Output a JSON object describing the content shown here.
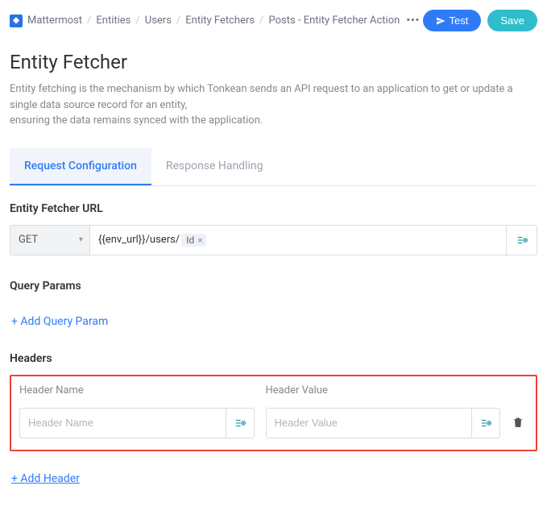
{
  "breadcrumb": {
    "items": [
      "Mattermost",
      "Entities",
      "Users",
      "Entity Fetchers",
      "Posts - Entity Fetcher Action"
    ]
  },
  "actions": {
    "test": "Test",
    "save": "Save"
  },
  "title": "Entity Fetcher",
  "description_line1": "Entity fetching is the mechanism by which Tonkean sends an API request to an application to get or update a single data source record for an entity,",
  "description_line2": "ensuring the data remains synced with the application.",
  "tabs": [
    {
      "label": "Request Configuration",
      "active": true
    },
    {
      "label": "Response Handling",
      "active": false
    }
  ],
  "url_section": {
    "label": "Entity Fetcher URL",
    "method": "GET",
    "prefix": "{{env_url}}/users/",
    "chip": "Id"
  },
  "query_section": {
    "label": "Query Params",
    "add_label": "+ Add Query Param"
  },
  "headers_section": {
    "label": "Headers",
    "name_label": "Header Name",
    "value_label": "Header Value",
    "name_placeholder": "Header Name",
    "value_placeholder": "Header Value",
    "add_label": "+ Add Header"
  }
}
